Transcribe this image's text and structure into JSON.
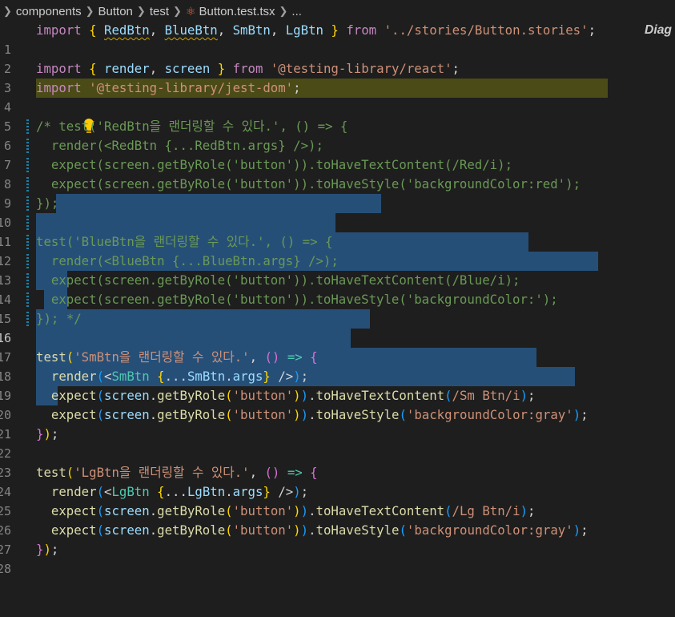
{
  "breadcrumb": {
    "items": [
      "components",
      "Button",
      "test",
      "Button.test.tsx",
      "..."
    ]
  },
  "editor": {
    "lines": [
      {
        "n": "1"
      },
      {
        "n": "2"
      },
      {
        "n": "3"
      },
      {
        "n": "4"
      },
      {
        "n": "5"
      },
      {
        "n": "6"
      },
      {
        "n": "7"
      },
      {
        "n": "8"
      },
      {
        "n": "9"
      },
      {
        "n": "10"
      },
      {
        "n": "11"
      },
      {
        "n": "12"
      },
      {
        "n": "13"
      },
      {
        "n": "14"
      },
      {
        "n": "15"
      },
      {
        "n": "16"
      },
      {
        "n": "17"
      },
      {
        "n": "18"
      },
      {
        "n": "19"
      },
      {
        "n": "20"
      },
      {
        "n": "21"
      },
      {
        "n": "22"
      },
      {
        "n": "23"
      },
      {
        "n": "24"
      },
      {
        "n": "25"
      },
      {
        "n": "26"
      },
      {
        "n": "27"
      },
      {
        "n": "28"
      }
    ],
    "inline_hint": "Diag",
    "colors": {
      "background": "#1e1e1e",
      "selection": "#264f78",
      "highlight_line": "#4b4b18",
      "keyword": "#c586c0",
      "string": "#ce9178",
      "variable": "#9cdcfe",
      "function": "#dcdcaa",
      "comment": "#6a9955"
    }
  }
}
